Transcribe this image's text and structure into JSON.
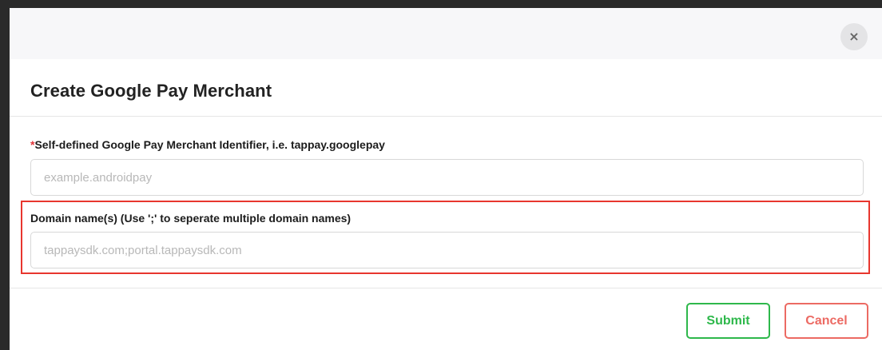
{
  "dialog": {
    "title": "Create Google Pay Merchant",
    "close_icon": "close-icon",
    "close_glyph": "×"
  },
  "fields": {
    "merchant_id": {
      "required_mark": "*",
      "label": "Self-defined Google Pay Merchant Identifier, i.e. tappay.googlepay",
      "value": "",
      "placeholder": "example.androidpay"
    },
    "domain_names": {
      "label": "Domain name(s) (Use ';' to seperate multiple domain names)",
      "value": "",
      "placeholder": "tappaysdk.com;portal.tappaysdk.com"
    }
  },
  "footer": {
    "submit_label": "Submit",
    "cancel_label": "Cancel"
  },
  "colors": {
    "submit": "#2eb84b",
    "cancel": "#ec6a63",
    "highlight": "#e8362e",
    "required": "#e0353a"
  }
}
